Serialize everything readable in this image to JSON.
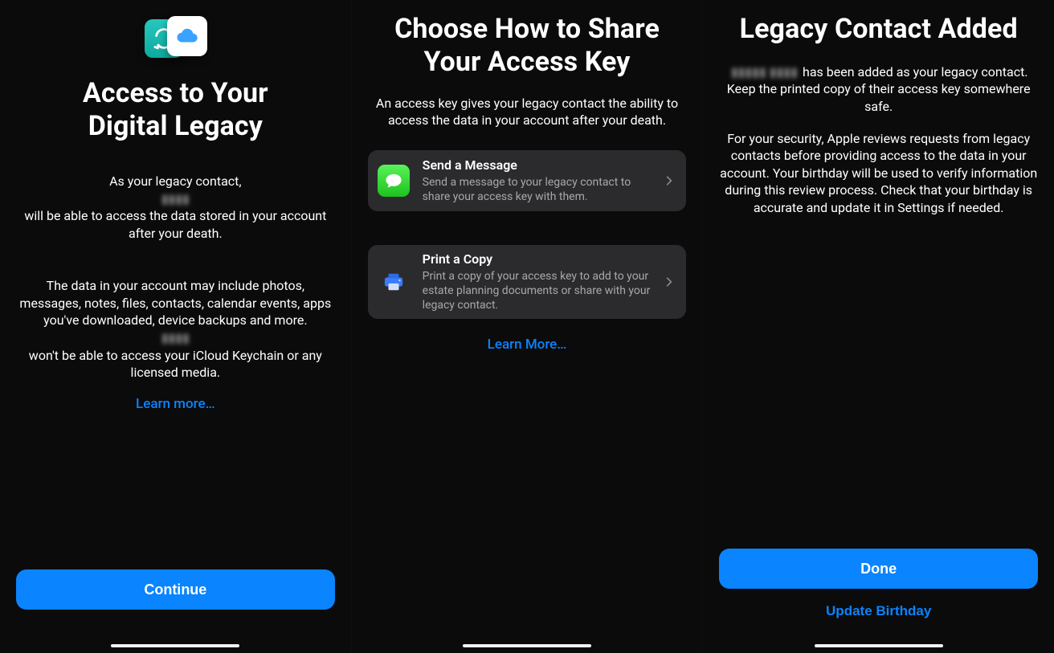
{
  "panel1": {
    "title": "Access to Your\nDigital Legacy",
    "paragraph_pre": "As your legacy contact, ",
    "redacted1": "▮▮▮▮",
    "paragraph_post": " will be able to access the data stored in your account after your death.",
    "paragraph2_pre": "The data in your account may include photos, messages, notes, files, contacts, calendar events, apps you've downloaded, device backups and more. ",
    "redacted2": "▮▮▮▮",
    "paragraph2_post": " won't be able to access your iCloud Keychain or any licensed media.",
    "learn_more": "Learn more…",
    "continue": "Continue"
  },
  "panel2": {
    "title": "Choose How to Share\nYour Access Key",
    "subhead": "An access key gives your legacy contact the ability to access the data in your account after your death.",
    "option_message": {
      "title": "Send a Message",
      "sub": "Send a message to your legacy contact to share your access key with them."
    },
    "option_print": {
      "title": "Print a Copy",
      "sub": "Print a copy of your access key to add to your estate planning documents or share with your legacy contact."
    },
    "learn_more": "Learn More…"
  },
  "panel3": {
    "title": "Legacy Contact Added",
    "redacted": "▮▮▮▮▮ ▮▮▮▮",
    "p1_post": " has been added as your legacy contact. Keep the printed copy of their access key somewhere safe.",
    "p2": "For your security, Apple reviews requests from legacy contacts before providing access to the data in your account. Your birthday will be used to verify information during this review process. Check that your birthday is accurate and update it in Settings if needed.",
    "done": "Done",
    "update_birthday": "Update Birthday"
  },
  "icons": {
    "hero_left": "transfer-icon",
    "hero_right": "cloud-icon",
    "messages": "messages-icon",
    "print": "printer-icon",
    "chevron": "chevron-right-icon"
  },
  "colors": {
    "accent": "#0a84ff",
    "card": "#2b2b2d",
    "background": "#0b0b0b"
  }
}
